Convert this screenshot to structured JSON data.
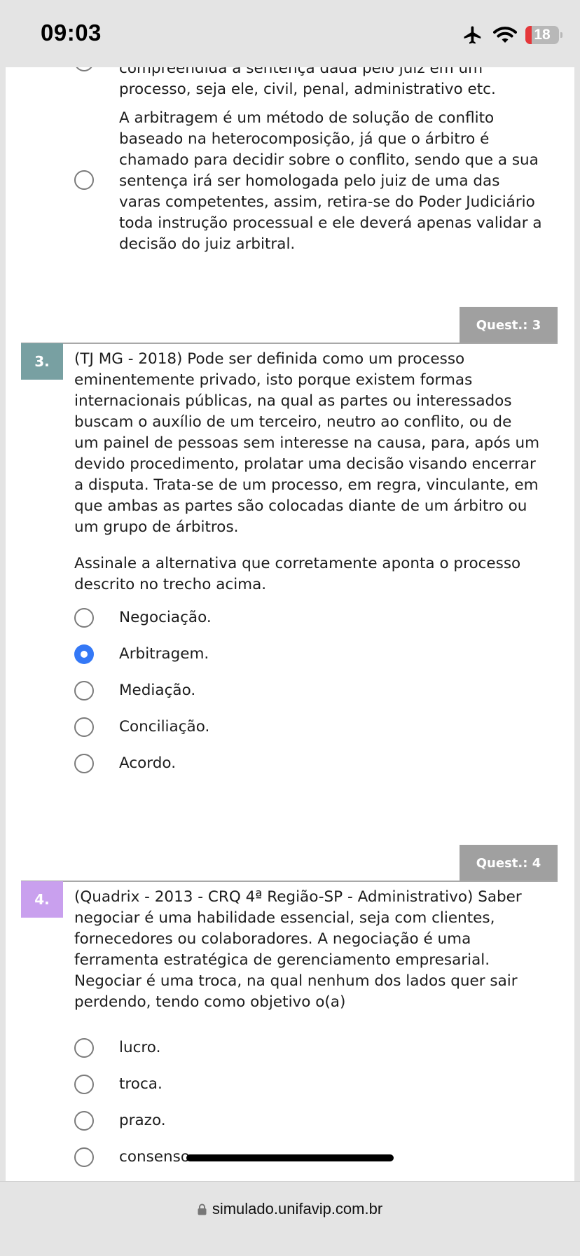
{
  "status_bar": {
    "time": "09:03",
    "battery_level": "18"
  },
  "partial_question": {
    "options": [
      {
        "lines": [
          "compreendida a sentença dada pelo juiz em um",
          "processo, seja ele, civil, penal, administrativo etc."
        ],
        "selected": false
      },
      {
        "lines": [
          "A arbitragem é um método de solução de conflito",
          "baseado na heterocomposição, já que o árbitro é",
          "chamado para decidir sobre o conflito, sendo que a sua",
          "sentença irá ser homologada pelo juiz de uma das",
          "varas competentes, assim, retira-se do Poder Judiciário",
          "toda instrução processual e ele deverá apenas validar a",
          "decisão do juiz arbitral."
        ],
        "selected": false
      }
    ]
  },
  "questions": [
    {
      "tag": "Quest.: 3",
      "number": "3.",
      "number_color": "#78a0a2",
      "statement_lines": [
        "(TJ MG - 2018) Pode ser definida como um processo",
        "eminentemente privado, isto porque existem formas",
        "internacionais públicas, na qual as partes ou interessados",
        "buscam o auxílio de um terceiro, neutro ao conflito, ou de",
        "um painel de pessoas sem interesse na causa, para, após um",
        "devido procedimento, prolatar uma decisão visando encerrar",
        "a disputa. Trata-se de um processo, em regra, vinculante, em",
        "que ambas as partes são colocadas diante de um árbitro ou",
        "um grupo de árbitros."
      ],
      "prompt_lines": [
        "Assinale a alternativa que corretamente aponta o processo",
        "descrito no trecho acima."
      ],
      "options": [
        {
          "label": "Negociação.",
          "selected": false
        },
        {
          "label": "Arbitragem.",
          "selected": true
        },
        {
          "label": "Mediação.",
          "selected": false
        },
        {
          "label": "Conciliação.",
          "selected": false
        },
        {
          "label": "Acordo.",
          "selected": false
        }
      ]
    },
    {
      "tag": "Quest.: 4",
      "number": "4.",
      "number_color": "#c9a0ee",
      "statement_lines": [
        "(Quadrix - 2013 - CRQ 4ª Região-SP - Administrativo) Saber",
        "negociar é uma habilidade essencial, seja com clientes,",
        "fornecedores ou colaboradores. A negociação é uma",
        "ferramenta estratégica de gerenciamento empresarial.",
        "Negociar é uma troca, na qual nenhum dos lados quer sair",
        "perdendo, tendo como objetivo o(a)"
      ],
      "options": [
        {
          "label": "lucro.",
          "selected": false
        },
        {
          "label": "troca.",
          "selected": false
        },
        {
          "label": "prazo.",
          "selected": false
        },
        {
          "label": "consenso.",
          "selected": false
        }
      ]
    }
  ],
  "browser": {
    "url": "simulado.unifavip.com.br"
  }
}
